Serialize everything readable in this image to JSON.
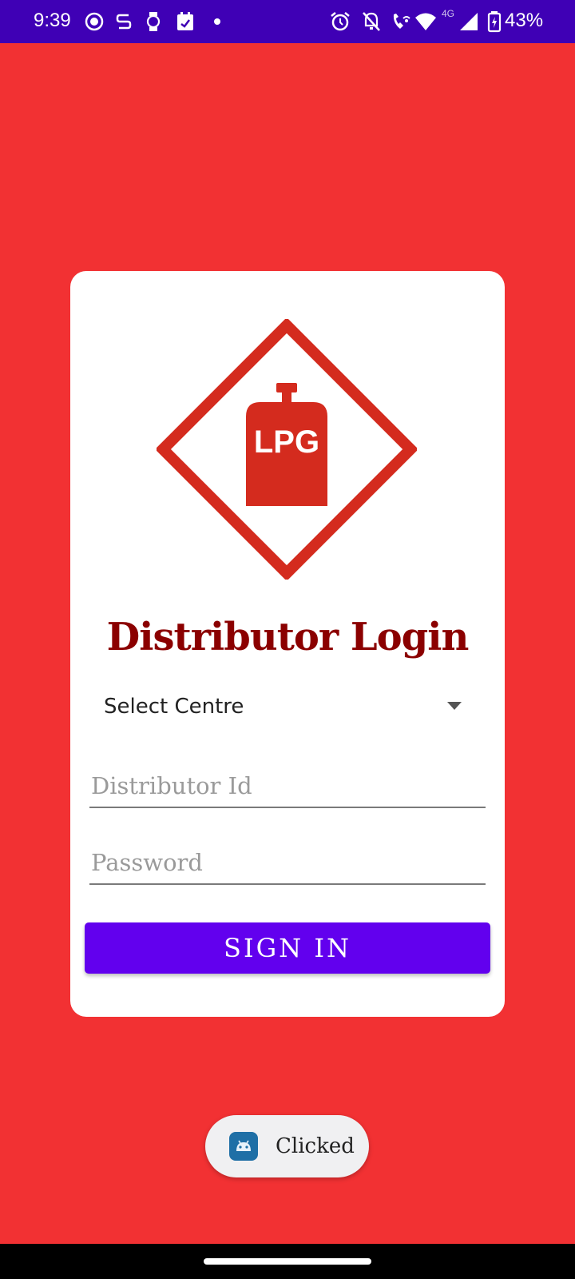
{
  "status_bar": {
    "time": "9:39",
    "network": "4G",
    "battery": "43%",
    "left_icons": [
      "screen-record-icon",
      "sync-icon",
      "watch-icon",
      "calendar-icon",
      "dot-icon"
    ],
    "right_icons": [
      "alarm-icon",
      "notifications-off-icon",
      "wifi-calling-icon",
      "wifi-icon",
      "signal-icon",
      "battery-charging-icon"
    ]
  },
  "card": {
    "logo_text": "LPG",
    "title": "Distributor Login",
    "spinner": {
      "selected": "Select Centre"
    },
    "distributor_id": {
      "placeholder": "Distributor Id",
      "value": ""
    },
    "password": {
      "placeholder": "Password",
      "value": ""
    },
    "sign_in_label": "SIGN IN"
  },
  "toast": {
    "text": "Clicked"
  },
  "colors": {
    "background": "#f23133",
    "status_bar": "#3f00b5",
    "title": "#8b0000",
    "button": "#6200ee",
    "logo_red": "#d42b1e"
  }
}
